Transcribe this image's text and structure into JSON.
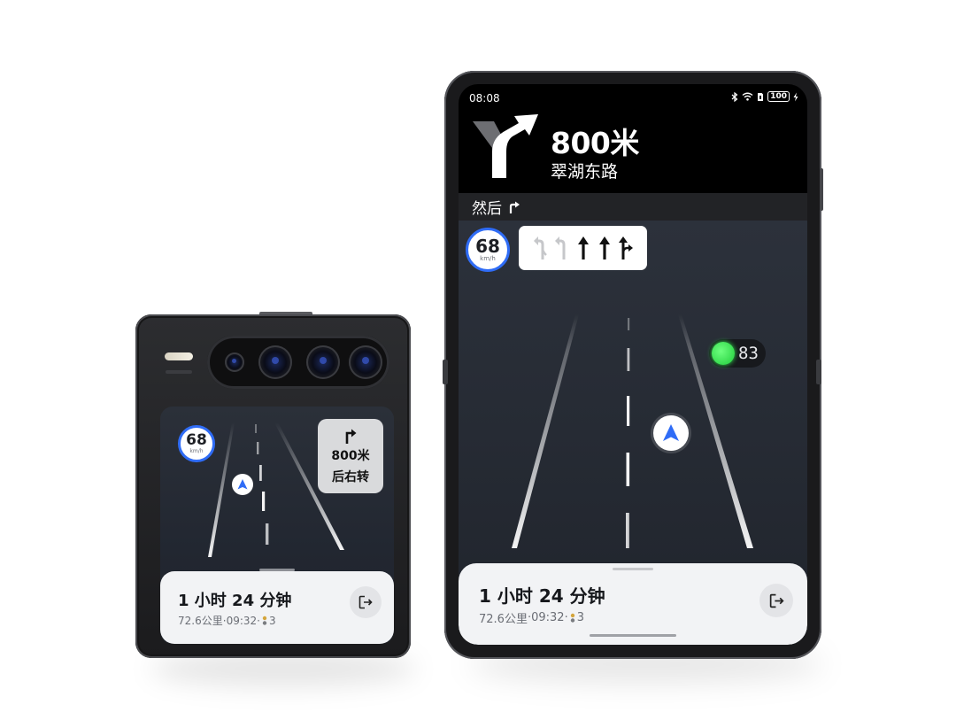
{
  "flip_phone": {
    "speed": {
      "value": "68",
      "unit": "km/h"
    },
    "turn_card": {
      "distance": "800米",
      "action": "后右转"
    },
    "trip": {
      "eta": "1 小时 24 分钟",
      "distance": "72.6公里",
      "arrival": "09:32",
      "lights": "3"
    }
  },
  "fold_phone": {
    "status": {
      "time": "08:08",
      "battery": "100"
    },
    "guidance": {
      "distance": "800米",
      "road": "翠湖东路",
      "then_label": "然后"
    },
    "speed": {
      "value": "68",
      "unit": "km/h"
    },
    "traffic_light": {
      "countdown": "83",
      "color": "#2ddc47"
    },
    "trip": {
      "eta": "1 小时 24 分钟",
      "distance": "72.6公里",
      "arrival": "09:32",
      "lights": "3"
    }
  },
  "colors": {
    "accent": "#2f6cf6",
    "map_bg": "#262b34",
    "sheet_bg": "#f2f3f5",
    "signal_green": "#2ddc47"
  },
  "icons": [
    "right-turn-icon",
    "exit-navigation-icon",
    "navigation-arrow-icon",
    "traffic-light-icon",
    "bluetooth-icon",
    "wifi-icon",
    "sim-icon",
    "battery-icon",
    "lane-arrow-icon",
    "fork-right-icon"
  ]
}
